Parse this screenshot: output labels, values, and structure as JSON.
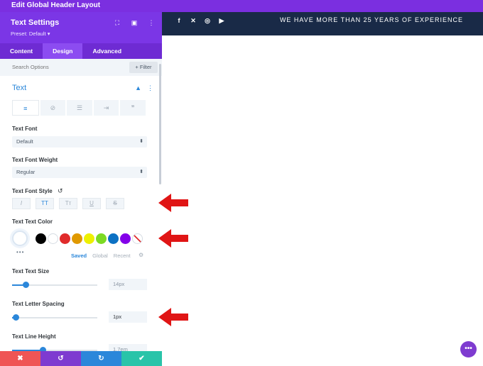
{
  "window": {
    "title": "Edit Global Header Layout"
  },
  "preview": {
    "social_icons": [
      "facebook-icon",
      "x-icon",
      "instagram-icon",
      "youtube-icon"
    ],
    "social_glyphs": [
      "f",
      "✕",
      "◎",
      "▶"
    ],
    "tagline": "WE HAVE MORE THAN 25 YEARS OF EXPERIENCE"
  },
  "panel": {
    "title": "Text Settings",
    "preset": "Preset: Default ▾",
    "header_icons": [
      "⛶",
      "▣",
      "⋮"
    ],
    "tabs": [
      "Content",
      "Design",
      "Advanced"
    ],
    "active_tab": "Design",
    "search_placeholder": "Search Options",
    "filter_label": "+ Filter",
    "section_title": "Text",
    "section_icons": [
      "▲",
      "⋮"
    ],
    "alignment_buttons": [
      "≡",
      "⊘",
      "☰",
      "⇥",
      "❞"
    ],
    "text_font": {
      "label": "Text Font",
      "value": "Default"
    },
    "text_font_weight": {
      "label": "Text Font Weight",
      "value": "Regular"
    },
    "text_font_style": {
      "label": "Text Font Style",
      "reset_glyph": "↺",
      "buttons": [
        "I",
        "TT",
        "Tт",
        "U",
        "S"
      ]
    },
    "text_color": {
      "label": "Text Text Color",
      "dots": "•••",
      "swatches": [
        "#000000",
        "#ffffff",
        "#e02b2b",
        "#e09900",
        "#edf000",
        "#7cda24",
        "#0c71c3",
        "#8300e9"
      ],
      "tabs": [
        "Saved",
        "Global",
        "Recent"
      ],
      "gear_glyph": "⚙"
    },
    "text_size": {
      "label": "Text Text Size",
      "value": "14px",
      "fraction": 0.16
    },
    "letter_spacing": {
      "label": "Text Letter Spacing",
      "value": "1px",
      "fraction": 0.04
    },
    "line_height": {
      "label": "Text Line Height",
      "value": "1.7em",
      "fraction": 0.36
    }
  },
  "actions": {
    "buttons": [
      {
        "glyph": "✖",
        "color": "#ef5555"
      },
      {
        "glyph": "↺",
        "color": "#7e3bd0"
      },
      {
        "glyph": "↻",
        "color": "#2b87da"
      },
      {
        "glyph": "✔",
        "color": "#29c4a9"
      }
    ]
  },
  "fab_glyph": "•••",
  "colors": {
    "accent": "#2b87da",
    "panel_purple": "#7b36e6",
    "arrow_red": "#e01515",
    "header_navy": "#192a47"
  }
}
